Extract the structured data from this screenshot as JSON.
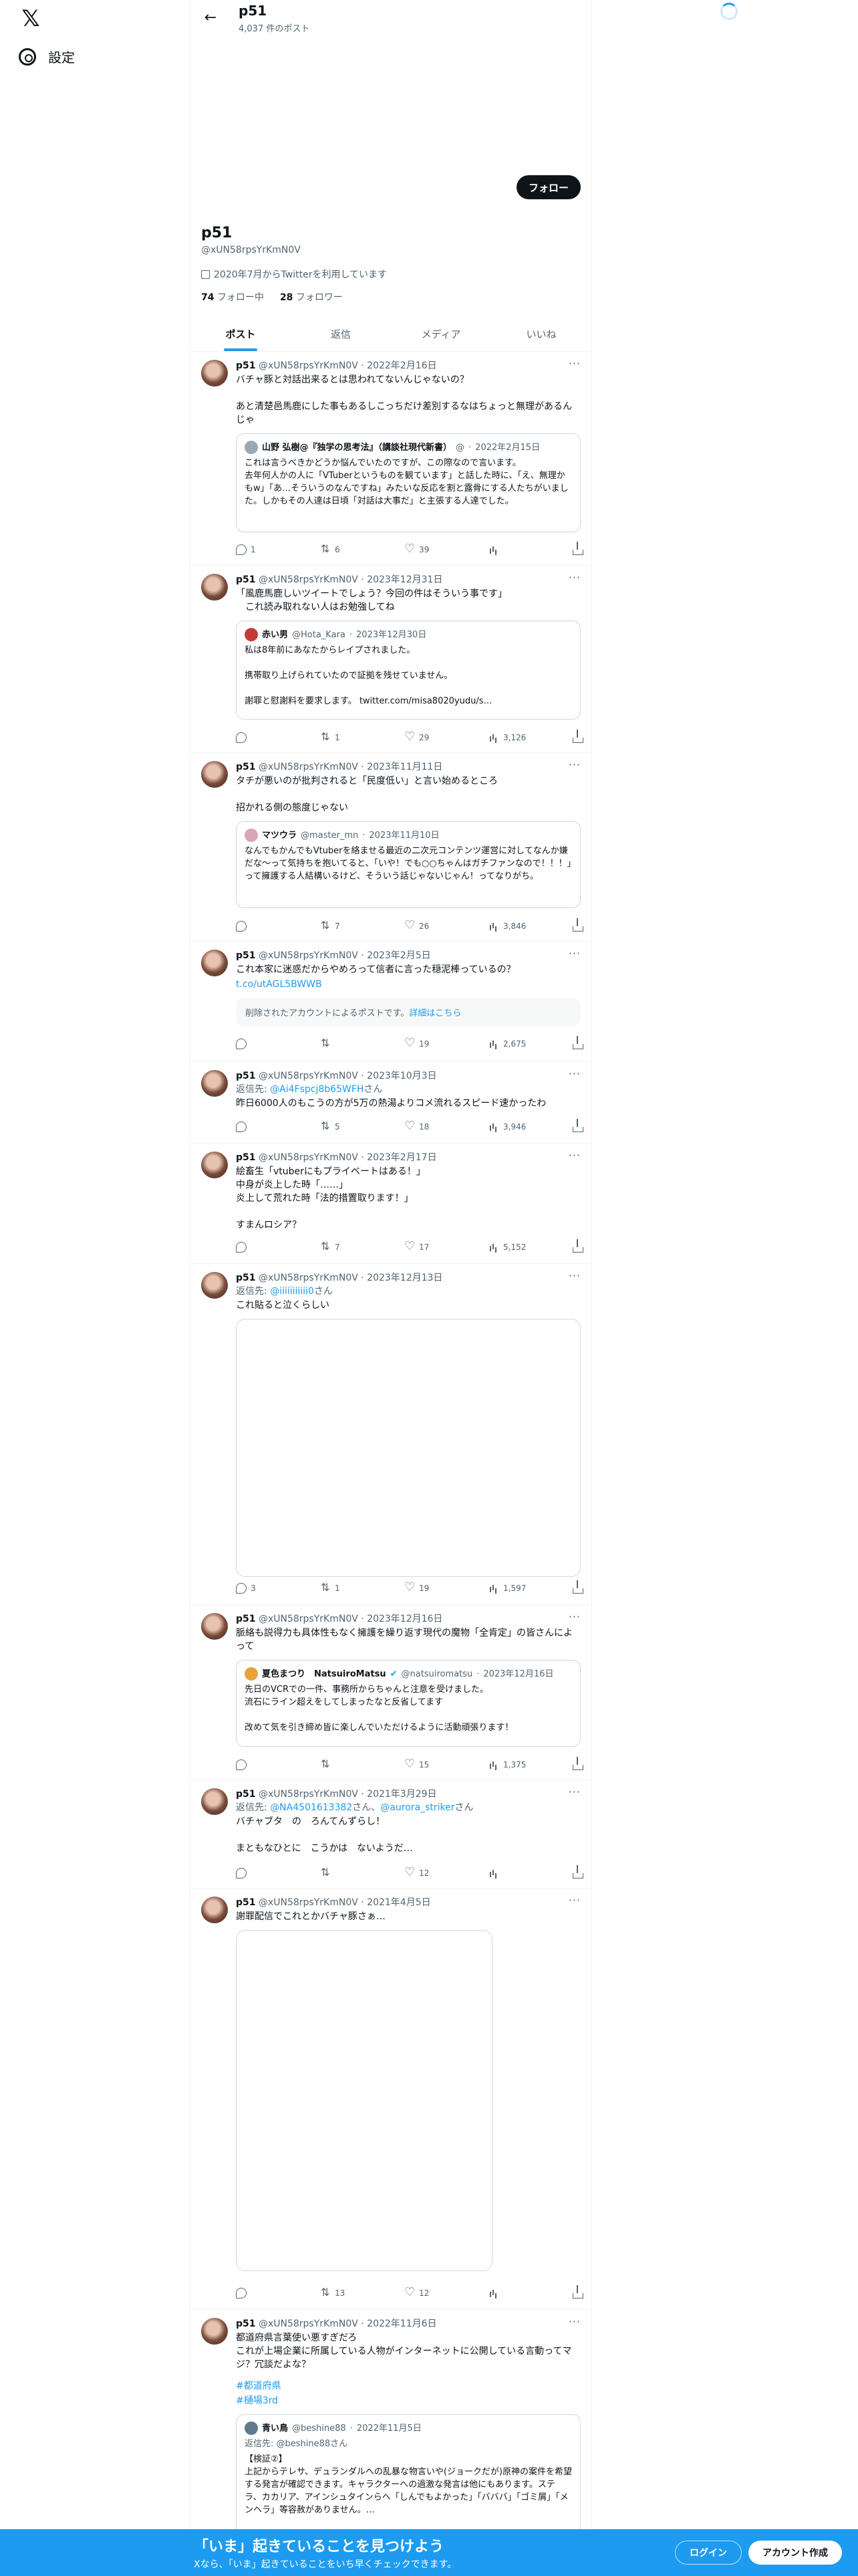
{
  "nav": {
    "settings_label": "設定"
  },
  "header": {
    "title": "p51",
    "post_count": "4,037 件のポスト"
  },
  "profile": {
    "name": "p51",
    "handle": "@xUN58rpsYrKmN0V",
    "joined": "2020年7月からTwitterを利用しています",
    "following_count": "74",
    "following_label": "フォロー中",
    "followers_count": "28",
    "followers_label": "フォロワー",
    "follow_button": "フォロー"
  },
  "tabs": [
    "ポスト",
    "返信",
    "メディア",
    "いいね"
  ],
  "tweets": [
    {
      "name": "p51",
      "handle": "@xUN58rpsYrKmN0V",
      "date": "2022年2月16日",
      "text": "バチャ豚と対話出来るとは思われてないんじゃないの？\n\nあと清楚邑馬鹿にした事もあるしこっちだけ差別するなはちょっと無理があるんじゃ",
      "quote": {
        "name": "山野 弘樹@『独学の思考法』（講談社現代新書）",
        "handle": "@",
        "date": "2022年2月15日",
        "text": "これは言うべきかどうか悩んでいたのですが、この際なので言います。\n去年何人かの人に「VTuberというものを観ています」と話した時に、「え、無理かもw」「あ…そういうのなんですね」みたいな反応を割と露骨にする人たちがいました。しかもその人達は日頃「対話は大事だ」と主張する人達でした。"
      },
      "stats": {
        "replies": "1",
        "retweets": "6",
        "likes": "39",
        "views": ""
      }
    },
    {
      "name": "p51",
      "handle": "@xUN58rpsYrKmN0V",
      "date": "2023年12月31日",
      "text": "「風鹿馬鹿しいツイートでしょう？今回の件はそういう事です」\n　これ読み取れない人はお勉強してね",
      "quote": {
        "name": "赤い男",
        "handle": "@Hota_Kara",
        "date": "2023年12月30日",
        "text": "私は8年前にあなたからレイプされました。\n\n携帯取り上げられていたので証拠を残せていません。\n\n謝罪と慰謝料を要求します。 twitter.com/misa8020yudu/s…"
      },
      "stats": {
        "replies": "",
        "retweets": "1",
        "likes": "29",
        "views": "3,126"
      }
    },
    {
      "name": "p51",
      "handle": "@xUN58rpsYrKmN0V",
      "date": "2023年11月11日",
      "text": "タチが悪いのが批判されると「民度低い」と言い始めるところ\n\n招かれる側の態度じゃない",
      "quote": {
        "name": "マツウラ",
        "handle": "@master_mn",
        "date": "2023年11月10日",
        "text": "なんでもかんでもVtuberを絡ませる最近の二次元コンテンツ運営に対してなんか嫌だな〜って気持ちを抱いてると、「いや！でも○○ちゃんはガチファンなので！！！」って擁護する人結構いるけど、そういう話じゃないじゃん！ってなりがち。"
      },
      "stats": {
        "replies": "",
        "retweets": "7",
        "likes": "26",
        "views": "3,846"
      }
    },
    {
      "name": "p51",
      "handle": "@xUN58rpsYrKmN0V",
      "date": "2023年2月5日",
      "text": "これ本家に迷惑だからやめろって信者に言った穏泥棒っているの？",
      "link": "t.co/utAGL5BWWB",
      "deleted_text": "削除されたアカウントによるポストです。",
      "deleted_link": "詳細はこちら",
      "stats": {
        "replies": "",
        "retweets": "",
        "likes": "19",
        "views": "2,675"
      }
    },
    {
      "name": "p51",
      "handle": "@xUN58rpsYrKmN0V",
      "date": "2023年10月3日",
      "reply_label": "返信先:",
      "reply_to": "@Ai4Fspcj8b65WFH",
      "reply_suffix": "さん",
      "text": "昨日6000人のもこうの方が5万の熱湯よりコメ流れるスピード速かったわ",
      "stats": {
        "replies": "",
        "retweets": "5",
        "likes": "18",
        "views": "3,946"
      }
    },
    {
      "name": "p51",
      "handle": "@xUN58rpsYrKmN0V",
      "date": "2023年2月17日",
      "text": "絵畜生「vtuberにもプライベートはある！」\n中身が炎上した時「……」\n炎上して荒れた時「法的措置取ります！」\n\nすまんロシア？",
      "stats": {
        "replies": "",
        "retweets": "7",
        "likes": "17",
        "views": "5,152"
      }
    },
    {
      "name": "p51",
      "handle": "@xUN58rpsYrKmN0V",
      "date": "2023年12月13日",
      "reply_label": "返信先:",
      "reply_to": "@iiiiiiiiiii0",
      "reply_suffix": "さん",
      "text": "これ貼ると泣くらしい",
      "stats": {
        "replies": "3",
        "retweets": "1",
        "likes": "19",
        "views": "1,597"
      }
    },
    {
      "name": "p51",
      "handle": "@xUN58rpsYrKmN0V",
      "date": "2023年12月16日",
      "text": "脈絡も説得力も具体性もなく擁護を繰り返す現代の魔物「全肯定」の皆さんによって",
      "quote": {
        "name": "夏色まつり　NatsuiroMatsu",
        "handle": "@natsuiromatsu",
        "date": "2023年12月16日",
        "text": "先日のVCRでの一件、事務所からちゃんと注意を受けました。\n流石にライン超えをしてしまったなと反省してます\n\n改めて気を引き締め皆に楽しんでいただけるように活動頑張ります！"
      },
      "stats": {
        "replies": "",
        "retweets": "",
        "likes": "15",
        "views": "1,375"
      }
    },
    {
      "name": "p51",
      "handle": "@xUN58rpsYrKmN0V",
      "date": "2021年3月29日",
      "reply_label": "返信先:",
      "reply_to": "@NA4501613382",
      "reply_mid": "さん、",
      "reply_to2": "@aurora_striker",
      "reply_suffix": "さん",
      "text": "バチャブタ　の　ろんてんずらし！\n\nまともなひとに　こうかは　ないようだ…",
      "stats": {
        "replies": "",
        "retweets": "",
        "likes": "12",
        "views": ""
      }
    },
    {
      "name": "p51",
      "handle": "@xUN58rpsYrKmN0V",
      "date": "2021年4月5日",
      "text": "謝罪配信でこれとかバチャ豚さぁ…",
      "stats": {
        "replies": "",
        "retweets": "13",
        "likes": "12",
        "views": ""
      }
    },
    {
      "name": "p51",
      "handle": "@xUN58rpsYrKmN0V",
      "date": "2022年11月6日",
      "text": "都道府県言葉使い悪すぎだろ\nこれが上場企業に所属している人物がインターネットに公開している言動ってマジ？冗談だよな？",
      "hashtags": [
        "#都道府県",
        "#樋場3rd"
      ],
      "quote": {
        "name": "青い鳥",
        "handle": "@beshine88",
        "date": "2022年11月5日",
        "reply": "返信先: @beshine88さん",
        "text": "【検証②】\n上記からテレサ、デュランダルへの乱暴な物言いや(ジョークだが)原神の案件を希望する発言が確認できます。キャラクターへの過激な発言は他にもあります。ステラ、カカリア、アインシュタインらへ「しんでもよかった」「バババ」「ゴミ屑」「メンヘラ」等容赦がありません。…"
      },
      "stats": {
        "replies": "",
        "retweets": "",
        "likes": "",
        "views": ""
      }
    }
  ],
  "bottom_bar": {
    "title": "「いま」起きていることを見つけよう",
    "subtitle": "Xなら、「いま」起きていることをいち早くチェックできます。",
    "login": "ログイン",
    "signup": "アカウント作成"
  }
}
